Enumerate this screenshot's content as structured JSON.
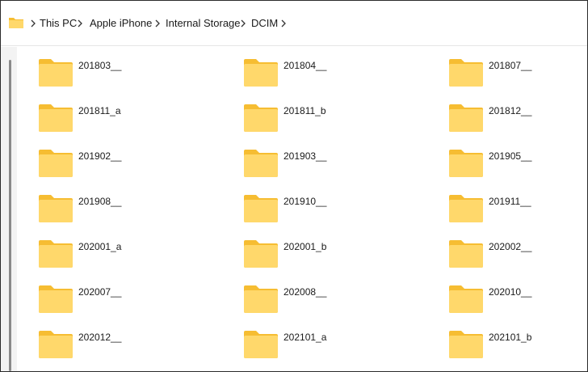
{
  "breadcrumb": {
    "icon": "folder-icon",
    "items": [
      "This PC",
      "Apple iPhone",
      "Internal Storage",
      "DCIM"
    ]
  },
  "colors": {
    "folder_front": "#ffd86b",
    "folder_back": "#f6bd32",
    "text": "#1a1a1a"
  },
  "folders": [
    "201803__",
    "201804__",
    "201807__",
    "201811_a",
    "201811_b",
    "201812__",
    "201902__",
    "201903__",
    "201905__",
    "201908__",
    "201910__",
    "201911__",
    "202001_a",
    "202001_b",
    "202002__",
    "202007__",
    "202008__",
    "202010__",
    "202012__",
    "202101_a",
    "202101_b"
  ]
}
